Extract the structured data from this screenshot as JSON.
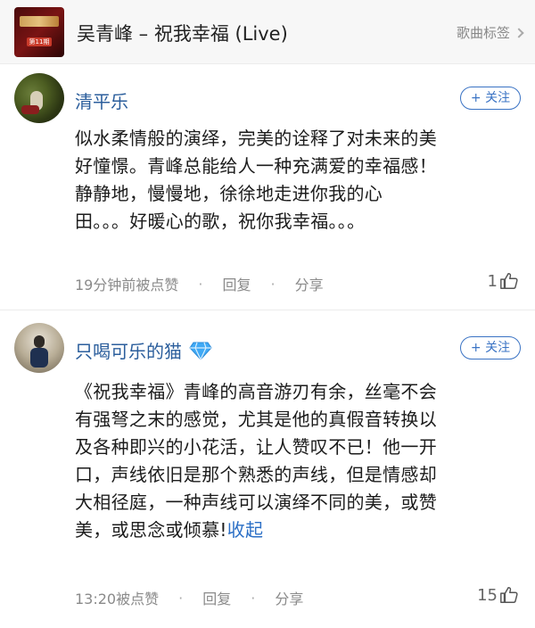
{
  "header": {
    "album_art_text": "第11期",
    "title": "吴青峰 – 祝我幸福 (Live)",
    "tag_link": "歌曲标签",
    "tag_icon": "chevron-right-icon"
  },
  "comments": [
    {
      "username": "清平乐",
      "verified": false,
      "follow_label": "+ 关注",
      "text_lines": [
        "似水柔情般的演绎，完美的诠释了对未来的美",
        "好憧憬。青峰总能给人一种充满爱的幸福感！",
        "静静地，慢慢地，徐徐地走进你我的心",
        "田。。。好暖心的歌，祝你我幸福。。。"
      ],
      "time": "19分钟前被点赞",
      "reply_label": "回复",
      "share_label": "分享",
      "like_count": "1"
    },
    {
      "username": "只喝可乐的猫",
      "verified": true,
      "verified_icon": "diamond-badge-icon",
      "follow_label": "+ 关注",
      "text_lines": [
        "《祝我幸福》青峰的高音游刃有余，丝毫不会",
        "有强弩之末的感觉，尤其是他的真假音转换以",
        "及各种即兴的小花活，让人赞叹不已！他一开",
        "口，声线依旧是那个熟悉的声线，但是情感却",
        "大相径庭，一种声线可以演绎不同的美，或赞",
        "美，或思念或倾慕!"
      ],
      "collapse_label": "收起",
      "time": "13:20被点赞",
      "reply_label": "回复",
      "share_label": "分享",
      "like_count": "15"
    }
  ],
  "colors": {
    "link_blue": "#2b5e9c",
    "accent_blue": "#3a73c4",
    "meta_gray": "#8a8a8a"
  }
}
